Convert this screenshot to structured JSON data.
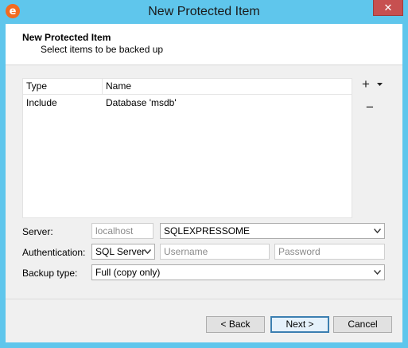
{
  "window": {
    "title": "New Protected Item",
    "app_icon_letter": "e",
    "close_label": "✕",
    "accent_color": "#5fc6ec"
  },
  "header": {
    "title": "New Protected Item",
    "subtitle": "Select items to be backed up"
  },
  "items_table": {
    "columns": [
      "Type",
      "Name"
    ],
    "rows": [
      {
        "type": "Include",
        "name": "Database 'msdb'"
      }
    ]
  },
  "side_actions": {
    "add_label": "+",
    "add_dropdown_icon": "chevron-down-icon",
    "remove_label": "−"
  },
  "form": {
    "server_label": "Server:",
    "server_host_value": "localhost",
    "server_instance_value": "SQLEXPRESSOME",
    "authentication_label": "Authentication:",
    "authentication_value": "SQL Server",
    "username_placeholder": "Username",
    "password_placeholder": "Password",
    "backup_type_label": "Backup type:",
    "backup_type_value": "Full (copy only)"
  },
  "buttons": {
    "back": "< Back",
    "next": "Next >",
    "cancel": "Cancel"
  }
}
